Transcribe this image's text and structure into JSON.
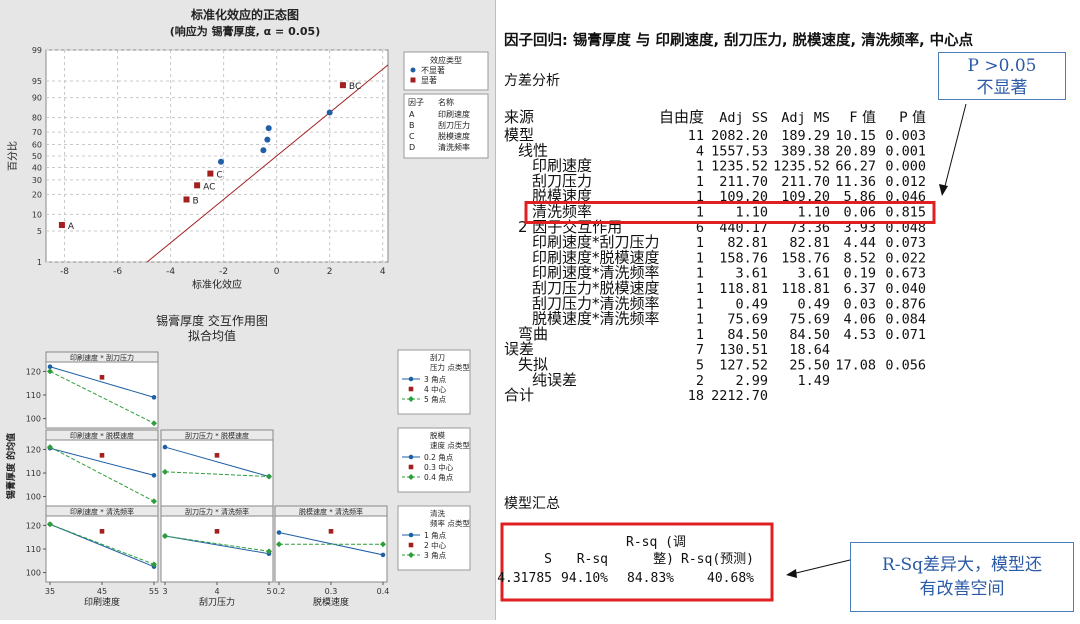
{
  "left": {
    "normal_plot": {
      "title": "标准化效应的正态图",
      "subtitle": "(响应为 锡膏厚度, α = 0.05)",
      "xlabel": "标准化效应",
      "ylabel": "百分比",
      "x_ticks": [
        "-8",
        "-6",
        "-4",
        "-2",
        "0",
        "2",
        "4"
      ],
      "y_ticks": [
        "1",
        "5",
        "10",
        "20",
        "30",
        "40",
        "50",
        "60",
        "70",
        "80",
        "90",
        "95",
        "99"
      ],
      "legend_title": "效应类型",
      "legend_items": [
        {
          "label": "不显著",
          "color": "#1f5fa6",
          "shape": "circle"
        },
        {
          "label": "显著",
          "color": "#a32020",
          "shape": "square"
        }
      ],
      "factor_header": [
        "因子",
        "名称"
      ],
      "factors": [
        {
          "code": "A",
          "name": "印刷速度"
        },
        {
          "code": "B",
          "name": "刮刀压力"
        },
        {
          "code": "C",
          "name": "脱模速度"
        },
        {
          "code": "D",
          "name": "清洗频率"
        }
      ]
    },
    "interaction_plot": {
      "title": "锡膏厚度 交互作用图",
      "subtitle": "拟合均值",
      "ylabel": "锡膏厚度 的均值",
      "panel_titles": [
        "印刷速度 * 刮刀压力",
        "印刷速度 * 脱模速度",
        "刮刀压力 * 脱模速度",
        "印刷速度 * 清洗频率",
        "刮刀压力 * 清洗频率",
        "脱模速度 * 清洗频率"
      ],
      "y_ticks": [
        "100",
        "110",
        "120"
      ],
      "x_labels": [
        "印刷速度",
        "刮刀压力",
        "脱模速度"
      ],
      "x_ticks": [
        [
          "35",
          "45",
          "55"
        ],
        [
          "3",
          "4",
          "5"
        ],
        [
          "0.2",
          "0.3",
          "0.4"
        ]
      ],
      "legends": [
        {
          "title": [
            "刮刀",
            "压力  点类型"
          ],
          "items": [
            "3  角点",
            "4  中心",
            "5  角点"
          ]
        },
        {
          "title": [
            "脱模",
            "速度  点类型"
          ],
          "items": [
            "0.2  角点",
            "0.3  中心",
            "0.4  角点"
          ]
        },
        {
          "title": [
            "清洗",
            "频率  点类型"
          ],
          "items": [
            "1  角点",
            "2  中心",
            "3  角点"
          ]
        }
      ],
      "colors": {
        "low": "#1f5fa6",
        "center": "#a32020",
        "high": "#2e9e3b"
      }
    }
  },
  "chart_data": [
    {
      "type": "scatter",
      "title": "标准化效应的正态图",
      "subtitle": "(响应为 锡膏厚度, α = 0.05)",
      "xlabel": "标准化效应",
      "ylabel": "百分比",
      "xlim": [
        -8.7,
        4.2
      ],
      "y_scale": "normal-probability",
      "ylim_percent": [
        1,
        99
      ],
      "grid": true,
      "legend_placement": "right",
      "reference_line": {
        "x_at_50": 0,
        "x_per_z": 2.1
      },
      "series": [
        {
          "name": "不显著",
          "points": [
            {
              "x": -2.1,
              "y": 45
            },
            {
              "x": -0.5,
              "y": 55
            },
            {
              "x": -0.35,
              "y": 64
            },
            {
              "x": -0.3,
              "y": 73
            },
            {
              "x": 2.0,
              "y": 83
            }
          ]
        },
        {
          "name": "显著",
          "points": [
            {
              "x": -8.1,
              "y": 6.5,
              "label": "A"
            },
            {
              "x": -3.4,
              "y": 17,
              "label": "B"
            },
            {
              "x": -3.0,
              "y": 26,
              "label": "AC"
            },
            {
              "x": -2.5,
              "y": 35,
              "label": "C"
            },
            {
              "x": 2.5,
              "y": 94,
              "label": "BC"
            }
          ]
        }
      ]
    },
    {
      "type": "line",
      "title": "锡膏厚度 交互作用图",
      "subtitle": "拟合均值",
      "ylabel": "锡膏厚度 的均值",
      "ylim": [
        96,
        124
      ],
      "panels": [
        {
          "title": "印刷速度 * 刮刀压力",
          "x": [
            35,
            45,
            55
          ],
          "series": [
            {
              "name": "3",
              "values": [
                122,
                null,
                109
              ]
            },
            {
              "name": "4",
              "values": [
                null,
                117.5,
                null
              ]
            },
            {
              "name": "5",
              "values": [
                120,
                null,
                98
              ]
            }
          ]
        },
        {
          "title": "印刷速度 * 脱模速度",
          "x": [
            35,
            45,
            55
          ],
          "series": [
            {
              "name": "0.2",
              "values": [
                120.5,
                null,
                109
              ]
            },
            {
              "name": "0.3",
              "values": [
                null,
                117.5,
                null
              ]
            },
            {
              "name": "0.4",
              "values": [
                121,
                null,
                98
              ]
            }
          ]
        },
        {
          "title": "刮刀压力 * 脱模速度",
          "x": [
            3,
            4,
            5
          ],
          "series": [
            {
              "name": "0.2",
              "values": [
                121,
                null,
                108.5
              ]
            },
            {
              "name": "0.3",
              "values": [
                null,
                117.5,
                null
              ]
            },
            {
              "name": "0.4",
              "values": [
                110.5,
                null,
                108.5
              ]
            }
          ]
        },
        {
          "title": "印刷速度 * 清洗频率",
          "x": [
            35,
            45,
            55
          ],
          "series": [
            {
              "name": "1",
              "values": [
                120.5,
                null,
                102.5
              ]
            },
            {
              "name": "2",
              "values": [
                null,
                117.5,
                null
              ]
            },
            {
              "name": "3",
              "values": [
                120.5,
                null,
                103.5
              ]
            }
          ]
        },
        {
          "title": "刮刀压力 * 清洗频率",
          "x": [
            3,
            4,
            5
          ],
          "series": [
            {
              "name": "1",
              "values": [
                115.5,
                null,
                108
              ]
            },
            {
              "name": "2",
              "values": [
                null,
                117.5,
                null
              ]
            },
            {
              "name": "3",
              "values": [
                115.5,
                null,
                109
              ]
            }
          ]
        },
        {
          "title": "脱模速度 * 清洗频率",
          "x": [
            0.2,
            0.3,
            0.4
          ],
          "series": [
            {
              "name": "1",
              "values": [
                117,
                null,
                107.5
              ]
            },
            {
              "name": "2",
              "values": [
                null,
                117.5,
                null
              ]
            },
            {
              "name": "3",
              "values": [
                112,
                null,
                112
              ]
            }
          ]
        }
      ]
    }
  ],
  "report": {
    "title": "因子回归: 锡膏厚度 与 印刷速度, 刮刀压力, 脱模速度, 清洗频率, 中心点",
    "anova_heading": "方差分析",
    "columns": [
      "来源",
      "自由度",
      "Adj SS",
      "Adj MS",
      "F 值",
      "P 值"
    ],
    "rows": [
      {
        "indent": 0,
        "source": "模型",
        "df": "11",
        "ss": "2082.20",
        "ms": "189.29",
        "f": "10.15",
        "p": "0.003"
      },
      {
        "indent": 1,
        "source": "线性",
        "df": "4",
        "ss": "1557.53",
        "ms": "389.38",
        "f": "20.89",
        "p": "0.001"
      },
      {
        "indent": 2,
        "source": "印刷速度",
        "df": "1",
        "ss": "1235.52",
        "ms": "1235.52",
        "f": "66.27",
        "p": "0.000"
      },
      {
        "indent": 2,
        "source": "刮刀压力",
        "df": "1",
        "ss": "211.70",
        "ms": "211.70",
        "f": "11.36",
        "p": "0.012"
      },
      {
        "indent": 2,
        "source": "脱模速度",
        "df": "1",
        "ss": "109.20",
        "ms": "109.20",
        "f": "5.86",
        "p": "0.046"
      },
      {
        "indent": 2,
        "source": "清洗频率",
        "df": "1",
        "ss": "1.10",
        "ms": "1.10",
        "f": "0.06",
        "p": "0.815"
      },
      {
        "indent": 1,
        "source": "2 因子交互作用",
        "df": "6",
        "ss": "440.17",
        "ms": "73.36",
        "f": "3.93",
        "p": "0.048"
      },
      {
        "indent": 2,
        "source": "印刷速度*刮刀压力",
        "df": "1",
        "ss": "82.81",
        "ms": "82.81",
        "f": "4.44",
        "p": "0.073"
      },
      {
        "indent": 2,
        "source": "印刷速度*脱模速度",
        "df": "1",
        "ss": "158.76",
        "ms": "158.76",
        "f": "8.52",
        "p": "0.022"
      },
      {
        "indent": 2,
        "source": "印刷速度*清洗频率",
        "df": "1",
        "ss": "3.61",
        "ms": "3.61",
        "f": "0.19",
        "p": "0.673"
      },
      {
        "indent": 2,
        "source": "刮刀压力*脱模速度",
        "df": "1",
        "ss": "118.81",
        "ms": "118.81",
        "f": "6.37",
        "p": "0.040"
      },
      {
        "indent": 2,
        "source": "刮刀压力*清洗频率",
        "df": "1",
        "ss": "0.49",
        "ms": "0.49",
        "f": "0.03",
        "p": "0.876"
      },
      {
        "indent": 2,
        "source": "脱模速度*清洗频率",
        "df": "1",
        "ss": "75.69",
        "ms": "75.69",
        "f": "4.06",
        "p": "0.084"
      },
      {
        "indent": 1,
        "source": "弯曲",
        "df": "1",
        "ss": "84.50",
        "ms": "84.50",
        "f": "4.53",
        "p": "0.071"
      },
      {
        "indent": 0,
        "source": "误差",
        "df": "7",
        "ss": "130.51",
        "ms": "18.64",
        "f": "",
        "p": ""
      },
      {
        "indent": 1,
        "source": "失拟",
        "df": "5",
        "ss": "127.52",
        "ms": "25.50",
        "f": "17.08",
        "p": "0.056"
      },
      {
        "indent": 2,
        "source": "纯误差",
        "df": "2",
        "ss": "2.99",
        "ms": "1.49",
        "f": "",
        "p": ""
      },
      {
        "indent": 0,
        "source": "合计",
        "df": "18",
        "ss": "2212.70",
        "ms": "",
        "f": "",
        "p": ""
      }
    ],
    "summary_heading": "模型汇总",
    "summary_header_top": "R-sq (调",
    "summary_columns": [
      "S",
      "R-sq",
      "整)",
      "R-sq(预测)"
    ],
    "summary_values": [
      "4.31785",
      "94.10%",
      "84.83%",
      "40.68%"
    ]
  },
  "annotations": {
    "p_note_line1": "P  >0.05",
    "p_note_line2": "不显著",
    "rsq_note_line1": "R-Sq差异大，模型还",
    "rsq_note_line2": "有改善空间",
    "highlight_color": "#e02020",
    "callout_color": "#2b5aa6"
  }
}
